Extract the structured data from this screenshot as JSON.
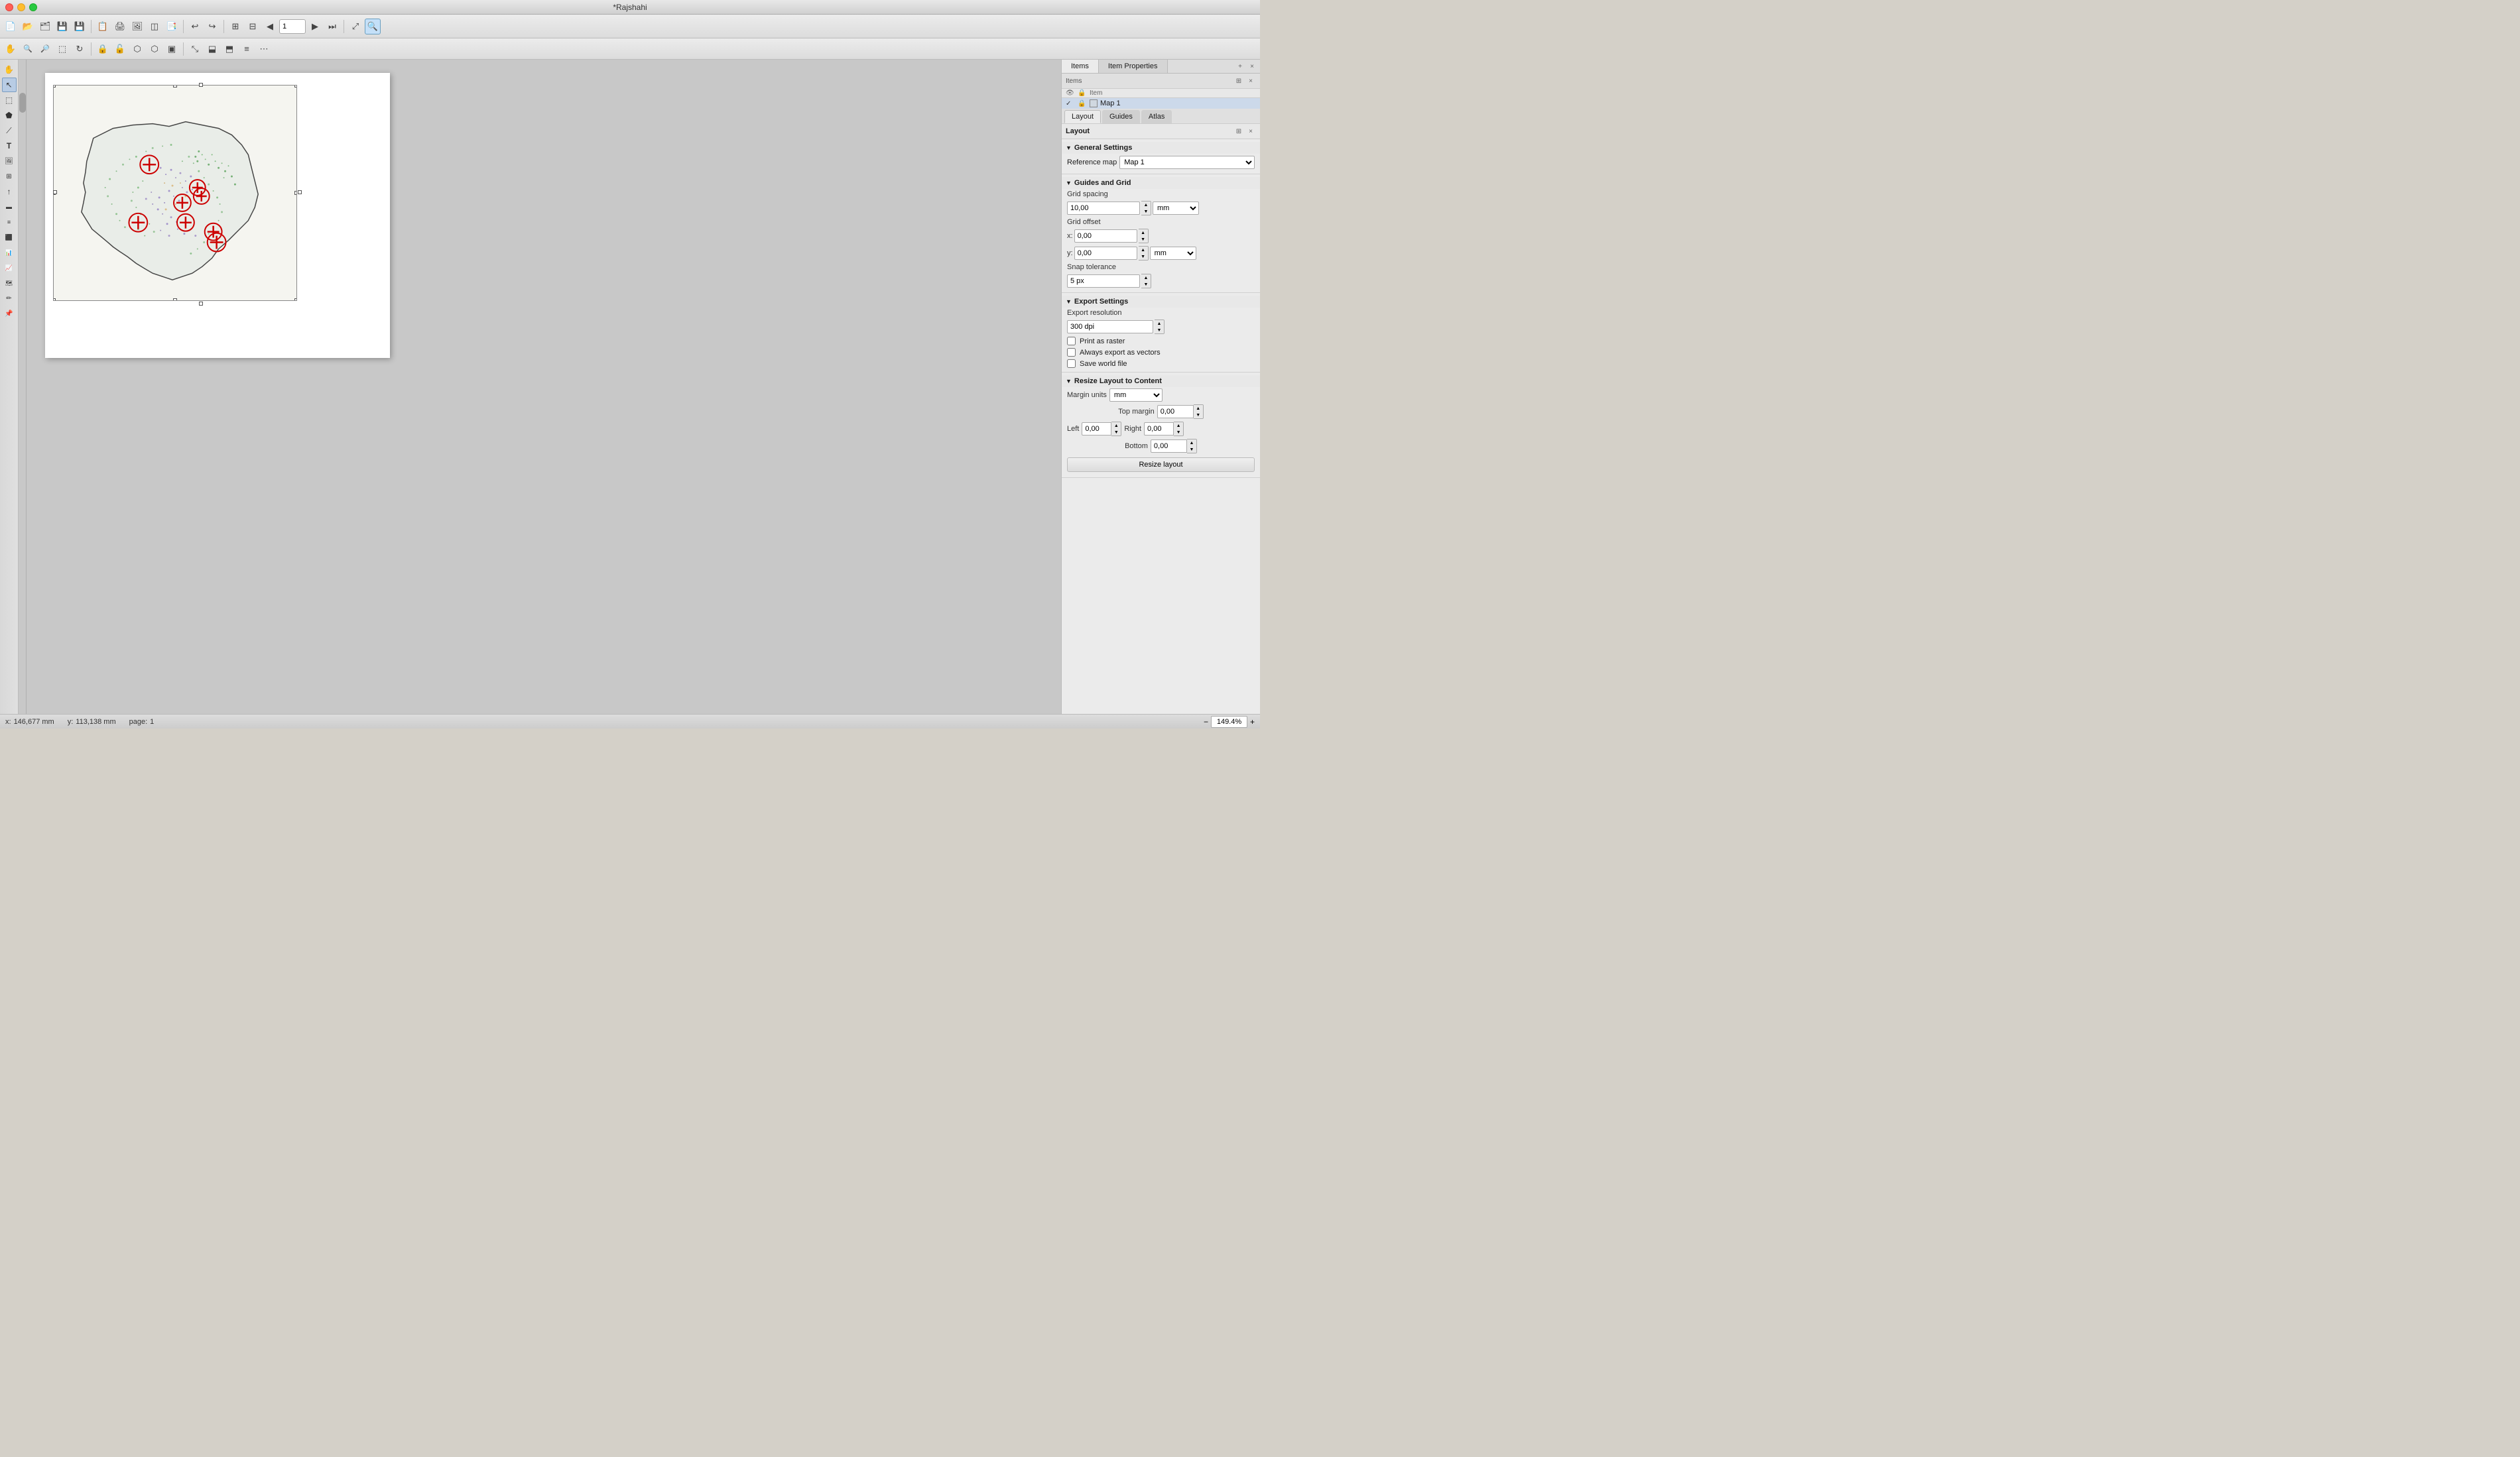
{
  "window": {
    "title": "*Rajshahi",
    "traffic_close": "●",
    "traffic_min": "●",
    "traffic_max": "●"
  },
  "toolbar1": {
    "buttons": [
      {
        "name": "new",
        "icon": "📄"
      },
      {
        "name": "open",
        "icon": "📂"
      },
      {
        "name": "open-project",
        "icon": "🗂"
      },
      {
        "name": "save",
        "icon": "💾"
      },
      {
        "name": "save-as",
        "icon": "💾"
      },
      {
        "name": "layout-manager",
        "icon": "📋"
      },
      {
        "name": "print",
        "icon": "🖨"
      },
      {
        "name": "export-image",
        "icon": "🖼"
      },
      {
        "name": "export-svg",
        "icon": "⬜"
      },
      {
        "name": "export-pdf",
        "icon": "📑"
      },
      {
        "name": "undo",
        "icon": "↩"
      },
      {
        "name": "redo",
        "icon": "↪"
      },
      {
        "name": "zoom-full",
        "icon": "⊞"
      },
      {
        "name": "zoom-all",
        "icon": "⊟"
      },
      {
        "name": "prev-page",
        "icon": "◀"
      },
      {
        "name": "page-input",
        "value": "1"
      },
      {
        "name": "next-page",
        "icon": "▶"
      },
      {
        "name": "last-page",
        "icon": "⏭"
      },
      {
        "name": "zoom-to-fit",
        "icon": "⤢"
      },
      {
        "name": "zoom-tool",
        "icon": "🔍"
      }
    ]
  },
  "toolbar2": {
    "buttons": [
      {
        "name": "pan",
        "icon": "✋"
      },
      {
        "name": "zoom-in",
        "icon": "🔍"
      },
      {
        "name": "zoom-out",
        "icon": "🔎"
      },
      {
        "name": "select",
        "icon": "⬚"
      },
      {
        "name": "refresh",
        "icon": "↻"
      },
      {
        "name": "lock",
        "icon": "🔒"
      },
      {
        "name": "unlock",
        "icon": "🔓"
      },
      {
        "name": "grouping",
        "icon": "⬡"
      },
      {
        "name": "ungroup",
        "icon": "⬡"
      },
      {
        "name": "select-group",
        "icon": "▣"
      },
      {
        "name": "resize",
        "icon": "⤡"
      },
      {
        "name": "align-left",
        "icon": "⬓"
      },
      {
        "name": "align-right",
        "icon": "⬒"
      },
      {
        "name": "distribute",
        "icon": "≡"
      },
      {
        "name": "more",
        "icon": "⋯"
      }
    ]
  },
  "toolbox": {
    "tools": [
      {
        "name": "pan-tool",
        "icon": "✋"
      },
      {
        "name": "select-tool",
        "icon": "↖"
      },
      {
        "name": "node-tool",
        "icon": "⬚"
      },
      {
        "name": "polygon-tool",
        "icon": "⬟"
      },
      {
        "name": "line-tool",
        "icon": "⟋"
      },
      {
        "name": "text-tool",
        "icon": "T"
      },
      {
        "name": "image-tool",
        "icon": "🖼"
      },
      {
        "name": "table-tool",
        "icon": "⊞"
      },
      {
        "name": "north-arrow",
        "icon": "↑"
      },
      {
        "name": "scale-bar",
        "icon": "⊟"
      },
      {
        "name": "legend",
        "icon": "≡"
      },
      {
        "name": "html-frame",
        "icon": "⬛"
      },
      {
        "name": "attribute-table",
        "icon": "📊"
      },
      {
        "name": "elevation-profile",
        "icon": "📈"
      },
      {
        "name": "3d-map",
        "icon": "🗺"
      },
      {
        "name": "annotate",
        "icon": "✏"
      },
      {
        "name": "pin",
        "icon": "📌"
      }
    ]
  },
  "items_panel": {
    "title": "Items",
    "columns": [
      "",
      "",
      "Item"
    ],
    "rows": [
      {
        "visible": true,
        "locked": false,
        "name": "Map 1",
        "type": "map",
        "selected": true
      }
    ]
  },
  "panel_tabs": [
    "Items",
    "Item Properties"
  ],
  "layout_tabs": [
    "Layout",
    "Guides",
    "Atlas"
  ],
  "layout_section_title": "Layout",
  "general_settings": {
    "title": "General Settings",
    "reference_map_label": "Reference map",
    "reference_map_value": "Map 1",
    "reference_map_options": [
      "Map 1"
    ]
  },
  "guides_grid": {
    "title": "Guides and Grid",
    "grid_spacing_label": "Grid spacing",
    "grid_spacing_value": "10,00",
    "grid_spacing_unit": "mm",
    "grid_offset_label": "Grid offset",
    "grid_offset_x_label": "x:",
    "grid_offset_x_value": "0,00",
    "grid_offset_y_label": "y:",
    "grid_offset_y_value": "0,00",
    "grid_offset_unit": "mm",
    "snap_tolerance_label": "Snap tolerance",
    "snap_tolerance_value": "5 px"
  },
  "export_settings": {
    "title": "Export Settings",
    "resolution_label": "Export resolution",
    "resolution_value": "300 dpi",
    "print_raster_label": "Print as raster",
    "always_export_vectors_label": "Always export as vectors",
    "save_world_file_label": "Save world file"
  },
  "resize_layout": {
    "title": "Resize Layout to Content",
    "margin_units_label": "Margin units",
    "margin_units_value": "mm",
    "top_margin_label": "Top margin",
    "top_margin_value": "0,00",
    "left_label": "Left",
    "left_value": "0,00",
    "right_label": "Right",
    "right_value": "0,00",
    "bottom_label": "Bottom",
    "bottom_value": "0,00",
    "button_label": "Resize layout"
  },
  "statusbar": {
    "x_label": "x:",
    "x_value": "146,677 mm",
    "y_label": "y:",
    "y_value": "113,138 mm",
    "page_label": "page:",
    "page_value": "1",
    "zoom_value": "149.4%"
  }
}
